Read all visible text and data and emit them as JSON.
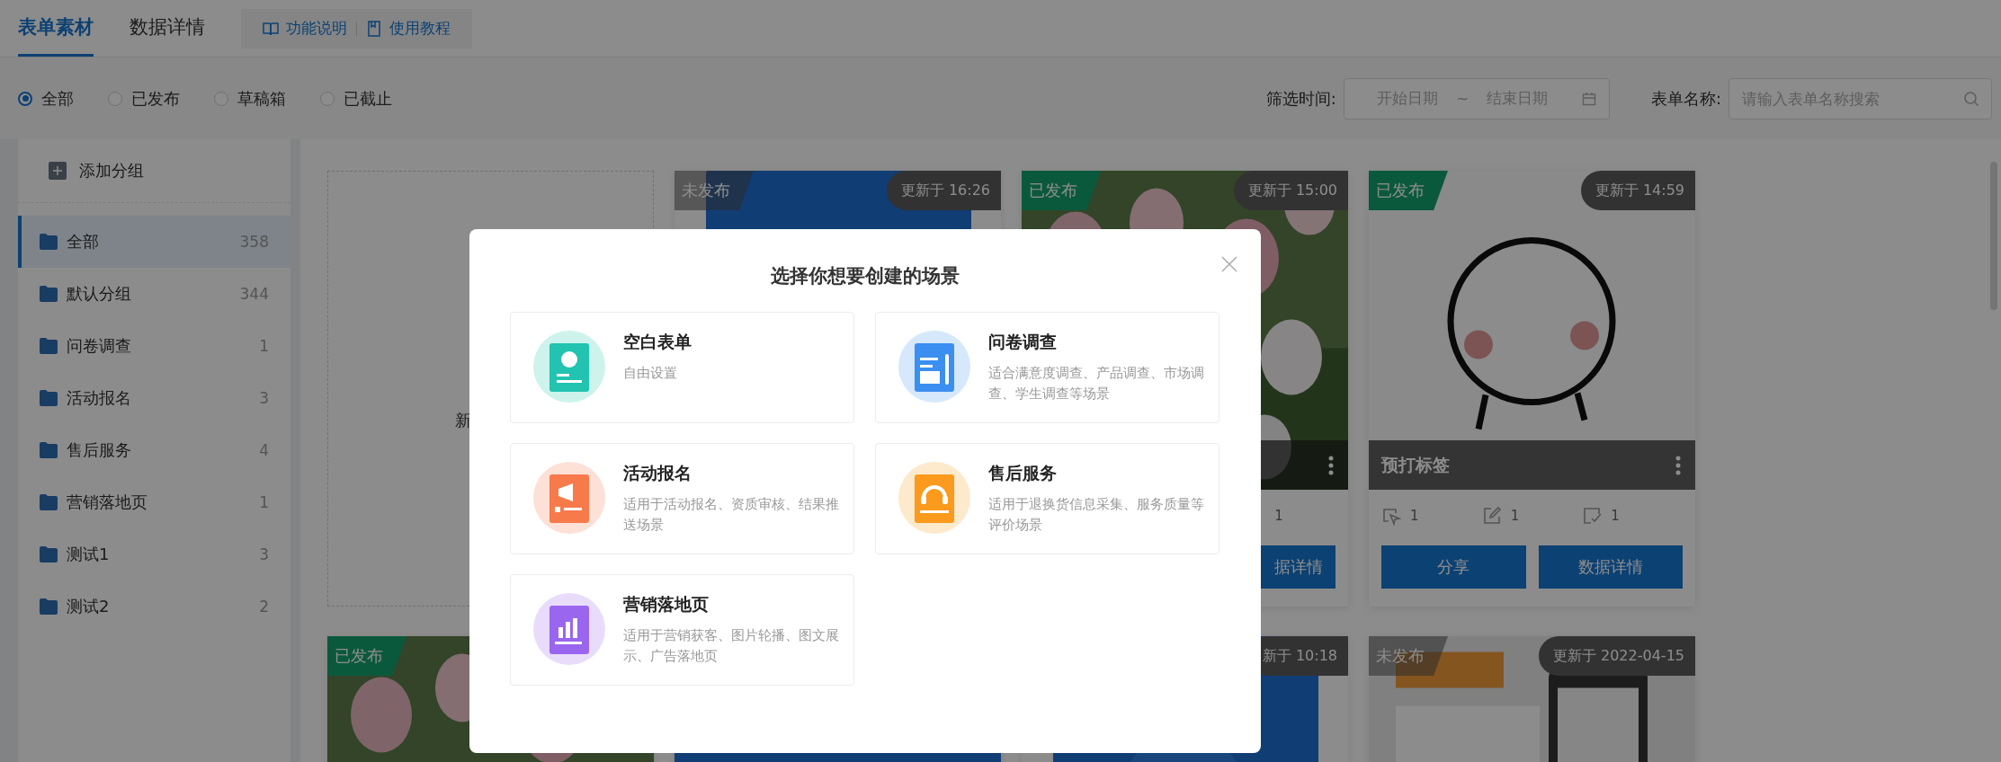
{
  "tabs": [
    {
      "label": "表单素材",
      "selected": true
    },
    {
      "label": "数据详情",
      "selected": false
    }
  ],
  "help_links": [
    {
      "label": "功能说明",
      "kind": "book"
    },
    {
      "label": "使用教程",
      "kind": "doc"
    }
  ],
  "status_filter": [
    {
      "label": "全部",
      "selected": true
    },
    {
      "label": "已发布",
      "selected": false
    },
    {
      "label": "草稿箱",
      "selected": false
    },
    {
      "label": "已截止",
      "selected": false
    }
  ],
  "date_filter": {
    "label": "筛选时间:",
    "start_placeholder": "开始日期",
    "separator": "~",
    "end_placeholder": "结束日期"
  },
  "name_filter": {
    "label": "表单名称:",
    "placeholder": "请输入表单名称搜索"
  },
  "sidebar": {
    "add_button": "添加分组",
    "items": [
      {
        "name": "全部",
        "count": "358",
        "selected": true
      },
      {
        "name": "默认分组",
        "count": "344",
        "selected": false
      },
      {
        "name": "问卷调查",
        "count": "1",
        "selected": false
      },
      {
        "name": "活动报名",
        "count": "3",
        "selected": false
      },
      {
        "name": "售后服务",
        "count": "4",
        "selected": false
      },
      {
        "name": "营销落地页",
        "count": "1",
        "selected": false
      },
      {
        "name": "测试1",
        "count": "3",
        "selected": false
      },
      {
        "name": "测试2",
        "count": "2",
        "selected": false
      }
    ]
  },
  "cards": [
    {
      "kind": "new",
      "text": "新"
    },
    {
      "kind": "form",
      "status": "未发布",
      "published": false,
      "updated": "更新于 16:26"
    },
    {
      "kind": "form",
      "status": "已发布",
      "published": true,
      "updated": "更新于 15:00",
      "covered": true,
      "menu": true,
      "stats": [
        {
          "kind": "submissions",
          "value": "1"
        }
      ],
      "buttons": [
        {
          "kind": "data",
          "label": "据详情"
        }
      ]
    },
    {
      "kind": "form",
      "status": "已发布",
      "published": true,
      "updated": "更新于 14:59",
      "covered": false,
      "title": "预打标签",
      "menu": true,
      "stats": [
        {
          "kind": "visits",
          "value": "1"
        },
        {
          "kind": "edits",
          "value": "1"
        },
        {
          "kind": "submissions",
          "value": "1"
        }
      ],
      "buttons": [
        {
          "kind": "share",
          "label": "分享"
        },
        {
          "kind": "data",
          "label": "数据详情"
        }
      ]
    },
    {
      "kind": "form",
      "status": "已发布",
      "published": true
    },
    {
      "kind": "hidden"
    },
    {
      "kind": "form",
      "updated": "新于 10:18"
    },
    {
      "kind": "form",
      "status": "未发布",
      "published": false,
      "updated": "更新于 2022-04-15"
    }
  ],
  "dialog": {
    "title": "选择你想要创建的场景",
    "options": [
      {
        "kind": "blank",
        "title": "空白表单",
        "description": "自由设置"
      },
      {
        "kind": "survey",
        "title": "问卷调查",
        "description": "适合满意度调查、产品调查、市场调查、学生调查等场景"
      },
      {
        "kind": "event",
        "title": "活动报名",
        "description": "适用于活动报名、资质审核、结果推送场景"
      },
      {
        "kind": "service",
        "title": "售后服务",
        "description": "适用于退换货信息采集、服务质量等评价场景"
      },
      {
        "kind": "marketing",
        "title": "营销落地页",
        "description": "适用于营销获客、图片轮播、图文展示、广告落地页"
      }
    ]
  }
}
